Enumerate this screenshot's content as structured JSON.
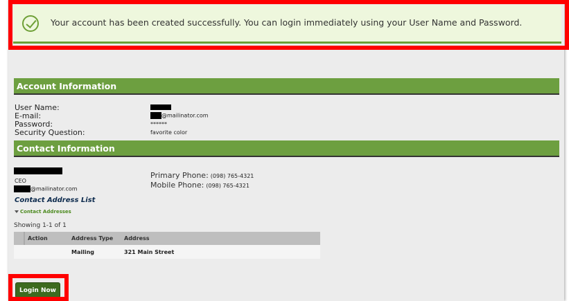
{
  "success": {
    "message": "Your account has been created successfully.  You can login immediately using your User Name and Password."
  },
  "account": {
    "header": "Account Information",
    "username_label": "User Name:",
    "email_label": "E-mail:",
    "email_suffix": "@mailinator.com",
    "password_label": "Password:",
    "password_value": "******",
    "security_label": "Security Question:",
    "security_value": "favorite color"
  },
  "contact": {
    "header": "Contact Information",
    "title": "CEO",
    "email_suffix": "@mailinator.com",
    "primary_phone_label": "Primary Phone:",
    "primary_phone_value": "(098) 765-4321",
    "mobile_phone_label": "Mobile Phone:",
    "mobile_phone_value": "(098) 765-4321",
    "address_list_title": "Contact Address List",
    "addresses_toggle": "Contact Addresses",
    "showing": "Showing 1-1 of 1",
    "table": {
      "headers": [
        "Action",
        "Address Type",
        "Address"
      ],
      "rows": [
        {
          "action": "",
          "type": "Mailing",
          "address": "321 Main Street"
        }
      ]
    }
  },
  "login_button": "Login Now",
  "colors": {
    "section_green": "#6d9f40",
    "button_green": "#3d6b1f",
    "success_bg": "#eef7dd",
    "highlight_red": "#ff0000"
  },
  "icons": {
    "success": "check-circle-icon",
    "toggle": "triangle-down-icon"
  }
}
